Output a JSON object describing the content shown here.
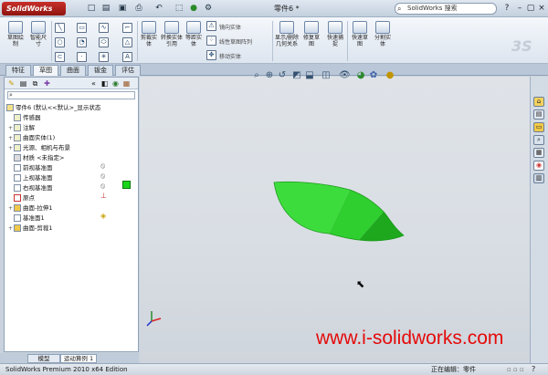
{
  "app": {
    "logo": "SolidWorks",
    "document_title": "零件6 *",
    "search_placeholder": "SolidWorks 搜索"
  },
  "window_controls": {
    "minimize": "–",
    "restore": "▢",
    "close": "×",
    "help": "?"
  },
  "ribbon": {
    "buttons": [
      {
        "label": "草图绘制",
        "icon": "sketch-icon"
      },
      {
        "label": "智能尺寸",
        "icon": "smart-dimension-icon"
      },
      {
        "label": "剪裁实体",
        "icon": "trim-icon"
      },
      {
        "label": "转换实体引用",
        "icon": "convert-entities-icon"
      },
      {
        "label": "等距实体",
        "icon": "offset-icon"
      },
      {
        "label": "显示/删除几何关系",
        "icon": "relations-icon"
      },
      {
        "label": "修复草图",
        "icon": "repair-sketch-icon"
      },
      {
        "label": "快速捕捉",
        "icon": "quick-snap-icon"
      },
      {
        "label": "快速草图",
        "icon": "rapid-sketch-icon"
      },
      {
        "label": "分割实体",
        "icon": "split-entities-icon"
      }
    ],
    "small_commands": {
      "mirror": "镜向实体",
      "linear_pattern": "线性草图阵列",
      "move": "移动实体"
    },
    "watermark_logo": "3S"
  },
  "tabs": [
    "特征",
    "草图",
    "曲面",
    "钣金",
    "评估"
  ],
  "active_tab": 1,
  "feature_tree": {
    "root": "零件6 (默认<<默认>_显示状态",
    "items": [
      {
        "label": "传感器",
        "icon": "sensor-icon",
        "expand": ""
      },
      {
        "label": "注解",
        "icon": "annotation-icon",
        "expand": "+"
      },
      {
        "label": "曲面实体(1)",
        "icon": "surface-body-icon",
        "expand": "+"
      },
      {
        "label": "光源、相机与布景",
        "icon": "lights-cameras-icon",
        "expand": "+"
      },
      {
        "label": "材质 <未指定>",
        "icon": "material-icon",
        "expand": ""
      },
      {
        "label": "前视基准面",
        "icon": "plane-icon",
        "expand": ""
      },
      {
        "label": "上视基准面",
        "icon": "plane-icon",
        "expand": ""
      },
      {
        "label": "右视基准面",
        "icon": "plane-icon",
        "expand": ""
      },
      {
        "label": "原点",
        "icon": "origin-icon",
        "expand": ""
      },
      {
        "label": "曲面-拉伸1",
        "icon": "surface-extrude-icon",
        "expand": "+"
      },
      {
        "label": "基准面1",
        "icon": "plane-icon",
        "expand": ""
      },
      {
        "label": "曲面-剪裁1",
        "icon": "surface-trim-icon",
        "expand": "+"
      }
    ]
  },
  "bottom_tabs": [
    "模型",
    "运动算例 1"
  ],
  "active_bottom_tab": 1,
  "graphics": {
    "watermark": "www.i-solidworks.com"
  },
  "status": {
    "edition": "SolidWorks Premium 2010 x64 Edition",
    "editing": "正在编辑：零件",
    "help": "?"
  },
  "colors": {
    "leaf_light": "#3ddc3d",
    "leaf_mid": "#2fcf2f",
    "leaf_dark": "#1da81d",
    "watermark": "#e40a0a",
    "logo_red": "#b3221c"
  }
}
